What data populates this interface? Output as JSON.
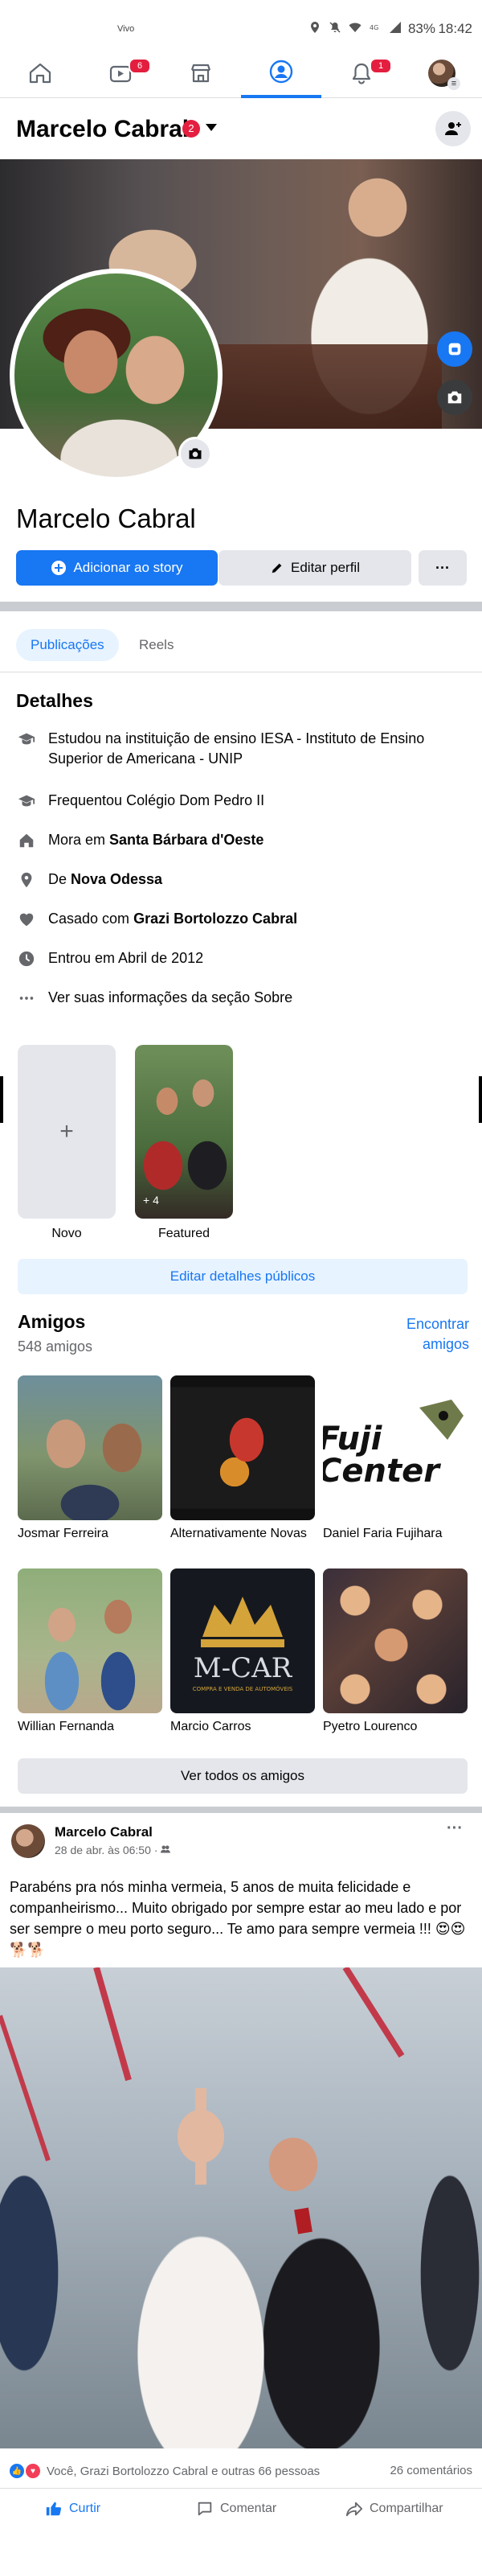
{
  "status_bar": {
    "carrier": "Vivo",
    "icons": [
      "location-icon",
      "mute-icon",
      "wifi-icon",
      "4g-icon",
      "signal-icon"
    ],
    "battery": "83%",
    "time": "18:42"
  },
  "tabs": [
    {
      "name": "home",
      "icon": "home-icon"
    },
    {
      "name": "watch",
      "icon": "video-icon",
      "badge": "6"
    },
    {
      "name": "marketplace",
      "icon": "store-icon"
    },
    {
      "name": "profile",
      "icon": "profile-icon",
      "active": true
    },
    {
      "name": "notifications",
      "icon": "bell-icon",
      "badge": "1"
    },
    {
      "name": "menu",
      "icon": "avatar-menu"
    }
  ],
  "profile": {
    "header_name": "Marcelo Cabral",
    "header_badge": "2",
    "name": "Marcelo Cabral",
    "add_story_label": "Adicionar ao story",
    "edit_profile_label": "Editar perfil",
    "more_label": "···"
  },
  "content_tabs": {
    "posts": "Publicações",
    "reels": "Reels"
  },
  "details": {
    "title": "Detalhes",
    "items": [
      {
        "icon": "graduation-cap-icon",
        "text": "Estudou na instituição de ensino IESA - Instituto de Ensino Superior de Americana - UNIP"
      },
      {
        "icon": "graduation-cap-icon",
        "text": "Frequentou Colégio Dom Pedro II"
      },
      {
        "icon": "house-icon",
        "prefix": "Mora em ",
        "bold": "Santa Bárbara d'Oeste"
      },
      {
        "icon": "location-pin-icon",
        "prefix": "De ",
        "bold": "Nova Odessa"
      },
      {
        "icon": "heart-icon",
        "prefix": "Casado com ",
        "bold": "Grazi Bortolozzo Cabral"
      },
      {
        "icon": "clock-icon",
        "text": "Entrou em Abril de 2012"
      },
      {
        "icon": "ellipsis-icon",
        "text": "Ver suas informações da seção Sobre"
      }
    ]
  },
  "featured": {
    "new_label": "Novo",
    "new_symbol": "+",
    "item_label": "Featured",
    "item_count": "+ 4"
  },
  "edit_public_details_label": "Editar detalhes públicos",
  "friends": {
    "title": "Amigos",
    "count": "548 amigos",
    "find_label": "Encontrar amigos",
    "list": [
      {
        "name": "Josmar Ferreira"
      },
      {
        "name": "Alternativamente Novas"
      },
      {
        "name": "Daniel Faria Fujihara"
      },
      {
        "name": "Willian Fernanda"
      },
      {
        "name": "Marcio Carros"
      },
      {
        "name": "Pyetro Lourenco"
      }
    ],
    "see_all_label": "Ver todos os amigos",
    "logo_fuji": "Fuji Center",
    "logo_mcar": "M-CAR",
    "logo_mcar_sub": "COMPRA E VENDA DE AUTOMÓVEIS"
  },
  "post": {
    "author": "Marcelo Cabral",
    "date": "28 de abr. às 06:50",
    "audience_icon": "friends-icon",
    "text": "Parabéns pra nós minha vermeia, 5 anos de muita felicidade e companheirismo... Muito obrigado por sempre estar ao meu lado e por ser sempre o meu porto seguro... Te amo para sempre vermeia !!! 😍😍🐕🐕",
    "reactions_text": "Você, Grazi Bortolozzo Cabral e outras 66 pessoas",
    "comments_text": "26 comentários",
    "like_label": "Curtir",
    "comment_label": "Comentar",
    "share_label": "Compartilhar"
  },
  "colors": {
    "accent": "#1877f2",
    "badge": "#e41e3f",
    "secondary_text": "#65676b",
    "button_gray": "#e4e6eb"
  }
}
